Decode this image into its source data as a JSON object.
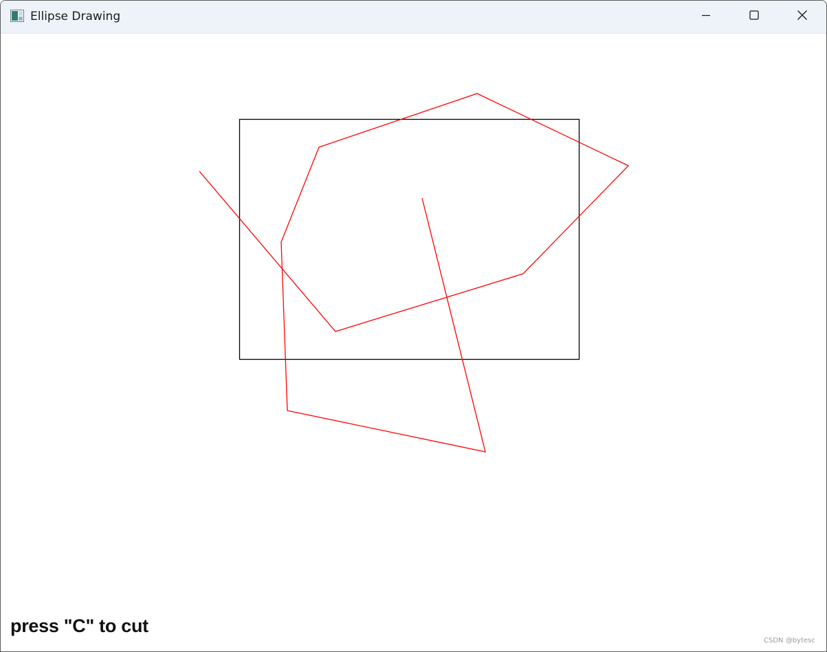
{
  "window": {
    "title": "Ellipse Drawing",
    "app_icon": "window-app-icon",
    "controls": {
      "minimize_icon": "minimize-icon",
      "maximize_icon": "maximize-icon",
      "close_icon": "close-icon"
    }
  },
  "drawing": {
    "clip_rectangle_color": "#000000",
    "polyline_color": "#ff0000"
  },
  "hint": {
    "text": "press \"C\" to cut"
  },
  "watermark": {
    "text": "CSDN @bytesc"
  }
}
